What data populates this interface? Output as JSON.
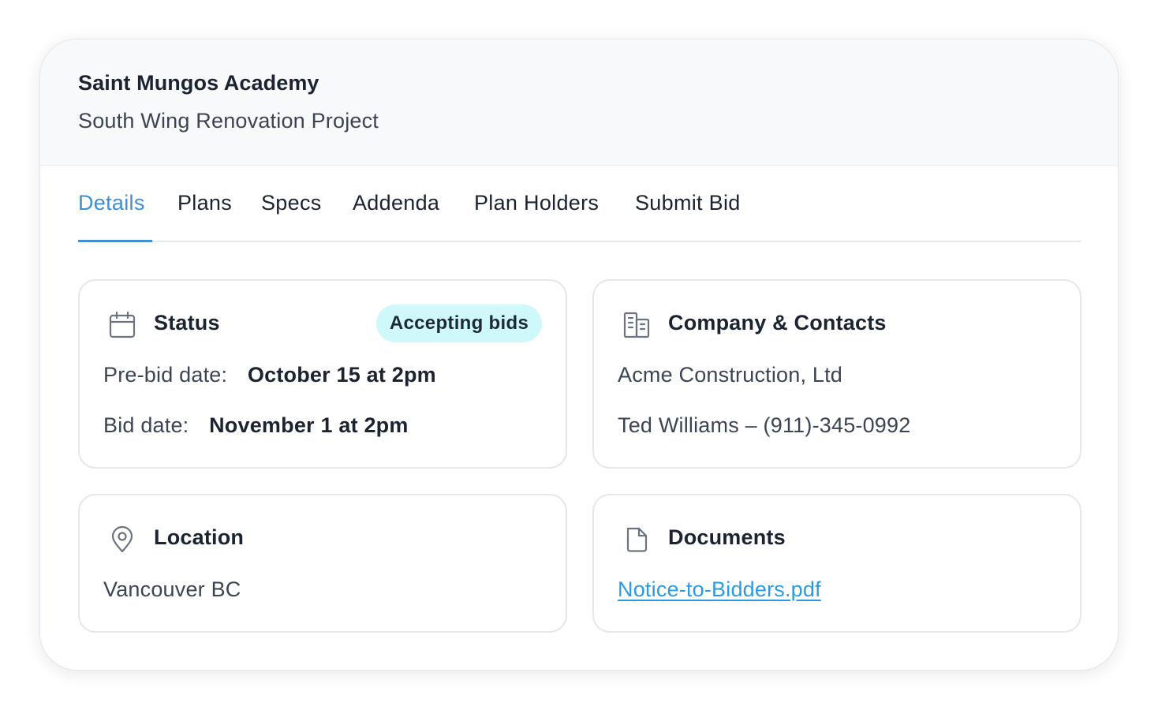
{
  "header": {
    "org_name": "Saint Mungos Academy",
    "project_name": "South Wing Renovation Project"
  },
  "tabs": [
    {
      "label": "Details",
      "active": true
    },
    {
      "label": "Plans",
      "active": false
    },
    {
      "label": "Specs",
      "active": false
    },
    {
      "label": "Addenda",
      "active": false
    },
    {
      "label": "Plan Holders",
      "active": false
    },
    {
      "label": "Submit Bid",
      "active": false
    }
  ],
  "status": {
    "icon": "calendar-icon",
    "title": "Status",
    "badge": "Accepting bids",
    "prebid_label": "Pre-bid date:",
    "prebid_value": "October 15 at 2pm",
    "bid_label": "Bid date:",
    "bid_value": "November 1 at 2pm"
  },
  "company": {
    "icon": "building-icon",
    "title": "Company & Contacts",
    "name": "Acme Construction, Ltd",
    "contact": "Ted Williams – (911)-345-0992"
  },
  "location": {
    "icon": "map-pin-icon",
    "title": "Location",
    "value": "Vancouver BC"
  },
  "documents": {
    "icon": "document-icon",
    "title": "Documents",
    "file": "Notice-to-Bidders.pdf"
  },
  "colors": {
    "accent": "#3e8fd0",
    "link": "#2b9be0",
    "badge_bg": "#cff8fb",
    "header_bg": "#f8f9fb"
  }
}
